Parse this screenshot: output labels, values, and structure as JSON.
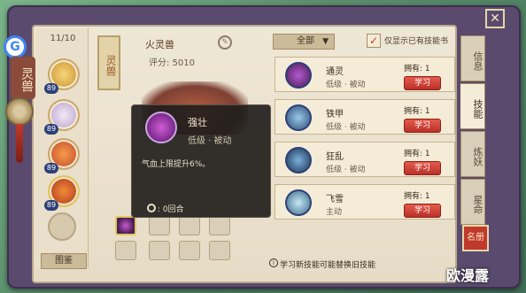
{
  "page_counter": "11/10",
  "pet": {
    "name": "火灵兽",
    "score": "评分: 5010",
    "tag": "灵兽"
  },
  "book_title": "灵兽",
  "pets_list": [
    {
      "level": "89"
    },
    {
      "level": "89"
    },
    {
      "level": "89"
    },
    {
      "level": "89"
    }
  ],
  "gallery_button": "图鉴",
  "tooltip": {
    "skill_name": "强壮",
    "skill_info": "低级 · 被动",
    "description": "气血上限提升6%。",
    "duration": ": 0回合"
  },
  "filter": {
    "selected": "全部",
    "checkbox_label": "仅显示已有技能书",
    "checked": true
  },
  "skills": [
    {
      "name": "通灵",
      "type": "低级 · 被动",
      "owned": "拥有: 1",
      "button": "学习",
      "color": "#b35ad1"
    },
    {
      "name": "铁甲",
      "type": "低级 · 被动",
      "owned": "拥有: 1",
      "button": "学习",
      "color": "#4a7ab8"
    },
    {
      "name": "狂乱",
      "type": "低级 · 被动",
      "owned": "拥有: 1",
      "button": "学习",
      "color": "#3a5a9a"
    },
    {
      "name": "飞雪",
      "type": "主动",
      "owned": "拥有: 1",
      "button": "学习",
      "color": "#6aa6c8"
    }
  ],
  "hint": "学习新技能可能替换旧技能",
  "tabs": [
    "信息",
    "技能",
    "炼妖",
    "星命"
  ],
  "seal_text": "名册",
  "watermark": "欧漫露"
}
